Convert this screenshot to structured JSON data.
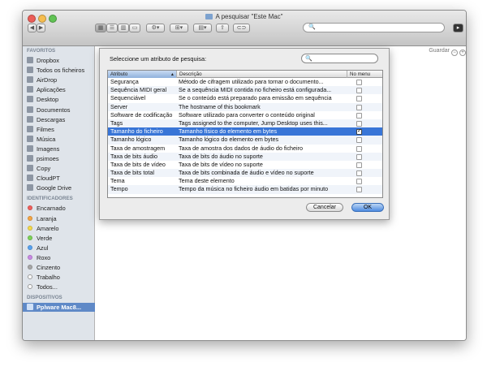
{
  "window": {
    "title": "A pesquisar \"Este Mac\"",
    "traffic_colors": [
      "#ec5d57",
      "#f5bd4f",
      "#61c354"
    ]
  },
  "toolbar": {
    "back_icon": "chevron-left-icon",
    "forward_icon": "chevron-right-icon",
    "view_buttons": [
      "icon-view",
      "list-view",
      "column-view",
      "coverflow-view"
    ],
    "search_placeholder": ""
  },
  "content": {
    "save_label": "Guardar"
  },
  "sidebar": {
    "favorites_heading": "FAVORITOS",
    "favorites": [
      {
        "label": "Dropbox",
        "icon": "dropbox-icon"
      },
      {
        "label": "Todos os ficheiros",
        "icon": "all-files-icon"
      },
      {
        "label": "AirDrop",
        "icon": "airdrop-icon"
      },
      {
        "label": "Aplicações",
        "icon": "applications-icon"
      },
      {
        "label": "Desktop",
        "icon": "desktop-icon"
      },
      {
        "label": "Documentos",
        "icon": "documents-icon"
      },
      {
        "label": "Descargas",
        "icon": "downloads-icon"
      },
      {
        "label": "Filmes",
        "icon": "movies-icon"
      },
      {
        "label": "Música",
        "icon": "music-icon"
      },
      {
        "label": "Imagens",
        "icon": "pictures-icon"
      },
      {
        "label": "psimoes",
        "icon": "home-icon"
      },
      {
        "label": "Copy",
        "icon": "folder-icon"
      },
      {
        "label": "CloudPT",
        "icon": "folder-icon"
      },
      {
        "label": "Google Drive",
        "icon": "folder-icon"
      }
    ],
    "tags_heading": "IDENTIFICADORES",
    "tags": [
      {
        "label": "Encarnado",
        "color": "#f0605c"
      },
      {
        "label": "Laranja",
        "color": "#f5a544"
      },
      {
        "label": "Amarelo",
        "color": "#f3d84b"
      },
      {
        "label": "Verde",
        "color": "#7dd257"
      },
      {
        "label": "Azul",
        "color": "#58a3f0"
      },
      {
        "label": "Roxo",
        "color": "#c98ae4"
      },
      {
        "label": "Cinzento",
        "color": "#a7a7a7"
      },
      {
        "label": "Trabalho",
        "color": "#ffffff"
      },
      {
        "label": "Todos...",
        "color": "#ffffff"
      }
    ],
    "devices_heading": "DISPOSITIVOS",
    "devices": [
      {
        "label": "Pplware Mac8...",
        "icon": "computer-icon",
        "selected": true
      }
    ]
  },
  "sheet": {
    "prompt": "Seleccione um atributo de pesquisa:",
    "search_placeholder": "",
    "columns": [
      "Atributo",
      "Descrição",
      "No menu"
    ],
    "rows": [
      {
        "attr": "Segurança",
        "desc": "Método de cifragem utilizado para tornar o documento...",
        "in_menu": false
      },
      {
        "attr": "Sequência MIDI geral",
        "desc": "Se a sequência MIDI contida no ficheiro está configurada...",
        "in_menu": false
      },
      {
        "attr": "Sequenciável",
        "desc": "Se o conteúdo está preparado para emissão em sequência",
        "in_menu": false
      },
      {
        "attr": "Server",
        "desc": "The hostname of this bookmark",
        "in_menu": false
      },
      {
        "attr": "Software de codificação",
        "desc": "Software utilizado para converter o conteúdo original",
        "in_menu": false
      },
      {
        "attr": "Tags",
        "desc": "Tags assigned to the computer, Jump Desktop uses this...",
        "in_menu": false
      },
      {
        "attr": "Tamanho do ficheiro",
        "desc": "Tamanho físico do elemento em bytes",
        "in_menu": true,
        "selected": true
      },
      {
        "attr": "Tamanho lógico",
        "desc": "Tamanho lógico do elemento em bytes",
        "in_menu": false
      },
      {
        "attr": "Taxa de amostragem",
        "desc": "Taxa de amostra dos dados de áudio do ficheiro",
        "in_menu": false
      },
      {
        "attr": "Taxa de bits áudio",
        "desc": "Taxa de bits do áudio no suporte",
        "in_menu": false
      },
      {
        "attr": "Taxa de bits de vídeo",
        "desc": "Taxa de bits de vídeo no suporte",
        "in_menu": false
      },
      {
        "attr": "Taxa de bits total",
        "desc": "Taxa de bits combinada de áudio e vídeo no suporte",
        "in_menu": false
      },
      {
        "attr": "Tema",
        "desc": "Tema deste elemento",
        "in_menu": false
      },
      {
        "attr": "Tempo",
        "desc": "Tempo da música no ficheiro áudio em batidas por minuto",
        "in_menu": false
      }
    ],
    "cancel_label": "Cancelar",
    "ok_label": "OK"
  }
}
